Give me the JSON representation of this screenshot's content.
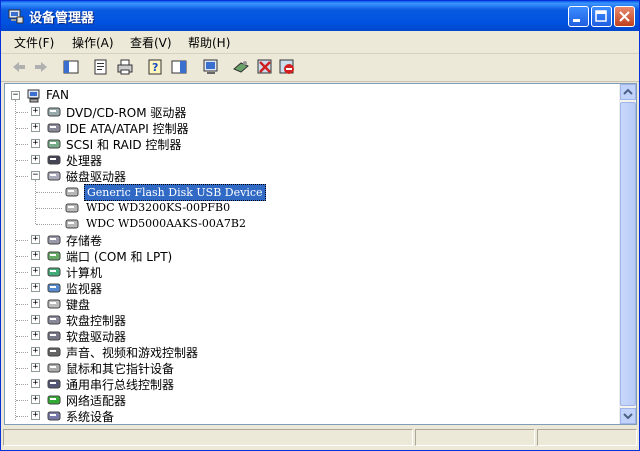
{
  "window": {
    "title": "设备管理器"
  },
  "menu": [
    "文件(F)",
    "操作(A)",
    "查看(V)",
    "帮助(H)"
  ],
  "toolbar": {
    "buttons": [
      "back-icon",
      "forward-icon",
      "show-hide-tree-icon",
      "properties-icon",
      "print-icon",
      "help-icon",
      "view-icon",
      "scan-hardware-icon",
      "update-driver-icon",
      "uninstall-icon",
      "disable-icon"
    ]
  },
  "tree": {
    "root": "FAN",
    "categories": [
      {
        "label": "DVD/CD-ROM 驱动器",
        "icon": "cdrom-icon"
      },
      {
        "label": "IDE ATA/ATAPI 控制器",
        "icon": "ide-controller-icon"
      },
      {
        "label": "SCSI 和 RAID 控制器",
        "icon": "scsi-icon"
      },
      {
        "label": "处理器",
        "icon": "processor-icon"
      },
      {
        "label": "磁盘驱动器",
        "icon": "disk-drive-icon",
        "expanded": true,
        "children": [
          "Generic Flash Disk USB Device",
          "WDC WD3200KS-00PFB0",
          "WDC WD5000AAKS-00A7B2"
        ]
      },
      {
        "label": "存储卷",
        "icon": "storage-volume-icon"
      },
      {
        "label": "端口 (COM 和 LPT)",
        "icon": "port-icon"
      },
      {
        "label": "计算机",
        "icon": "computer-icon"
      },
      {
        "label": "监视器",
        "icon": "monitor-icon"
      },
      {
        "label": "键盘",
        "icon": "keyboard-icon"
      },
      {
        "label": "软盘控制器",
        "icon": "floppy-controller-icon"
      },
      {
        "label": "软盘驱动器",
        "icon": "floppy-drive-icon"
      },
      {
        "label": "声音、视频和游戏控制器",
        "icon": "sound-icon"
      },
      {
        "label": "鼠标和其它指针设备",
        "icon": "mouse-icon"
      },
      {
        "label": "通用串行总线控制器",
        "icon": "usb-icon"
      },
      {
        "label": "网络适配器",
        "icon": "network-adapter-icon"
      },
      {
        "label": "系统设备",
        "icon": "system-device-icon"
      }
    ],
    "selected_child": "Generic Flash Disk USB Device"
  },
  "colors": {
    "selection": "#316AC5",
    "titlebar": "#0A5AE0"
  }
}
